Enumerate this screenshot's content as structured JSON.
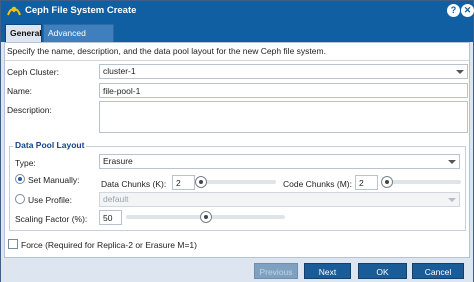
{
  "window": {
    "title": "Ceph File System Create"
  },
  "tabs": [
    {
      "label": "General"
    },
    {
      "label": "Advanced Settings"
    }
  ],
  "intro_text": "Specify the name, description, and the data pool layout for the new Ceph file system.",
  "form": {
    "cluster_label": "Ceph Cluster:",
    "cluster_value": "cluster-1",
    "name_label": "Name:",
    "name_value": "file-pool-1",
    "description_label": "Description:",
    "description_value": ""
  },
  "pool_layout": {
    "legend": "Data Pool Layout",
    "type_label": "Type:",
    "type_value": "Erasure",
    "set_manually_label": "Set Manually:",
    "set_manually_checked": true,
    "data_chunks_label": "Data Chunks (K):",
    "data_chunks_value": "2",
    "data_chunks_level": 0.02,
    "code_chunks_label": "Code Chunks (M):",
    "code_chunks_value": "2",
    "code_chunks_level": 0.02,
    "use_profile_label": "Use Profile:",
    "use_profile_checked": false,
    "profile_value": "default",
    "scaling_label": "Scaling Factor (%):",
    "scaling_value": "50",
    "scaling_level": 0.5
  },
  "force": {
    "label": "Force (Required for Replica-2 or Erasure M=1)",
    "checked": false
  },
  "buttons": {
    "previous": "Previous",
    "next": "Next",
    "ok": "OK",
    "cancel": "Cancel"
  },
  "colors": {
    "title_bar": "#0f5fa2",
    "button": "#1a5c97",
    "legend": "#15428b"
  },
  "icons": {
    "app": "ceph-logo-icon",
    "help": "help-icon",
    "close": "close-icon"
  }
}
